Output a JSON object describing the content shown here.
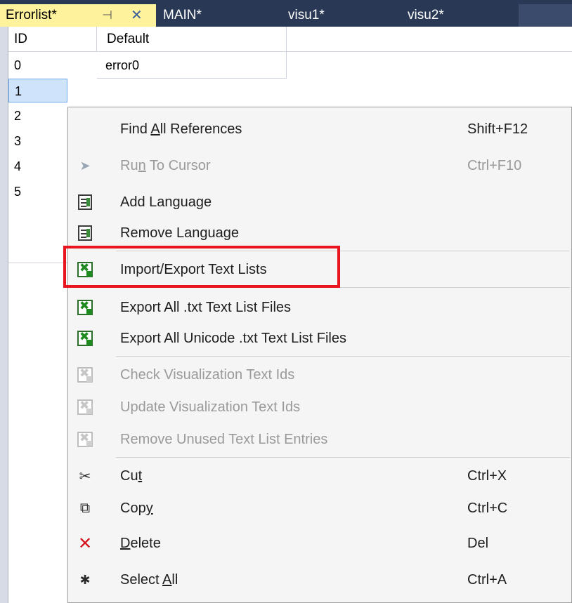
{
  "tabs": [
    {
      "label": "Errorlist*",
      "active": true
    },
    {
      "label": "MAIN*",
      "active": false
    },
    {
      "label": "visu1*",
      "active": false
    },
    {
      "label": "visu2*",
      "active": false
    }
  ],
  "tab_controls": {
    "pin_icon": "pin-icon",
    "close_icon": "close-icon"
  },
  "grid": {
    "columns": [
      "ID",
      "Default"
    ],
    "rows": [
      {
        "id": "0",
        "default": "error0"
      },
      {
        "id": "1",
        "default": ""
      },
      {
        "id": "2",
        "default": ""
      },
      {
        "id": "3",
        "default": ""
      },
      {
        "id": "4",
        "default": ""
      },
      {
        "id": "5",
        "default": ""
      }
    ],
    "selected_row_id": "1"
  },
  "context_menu": {
    "items": [
      {
        "label_pre": "Find ",
        "label_u": "A",
        "label_post": "ll References",
        "shortcut": "Shift+F12",
        "icon": "none",
        "enabled": true
      },
      {
        "label_pre": "Ru",
        "label_u": "n",
        "label_post": " To Cursor",
        "shortcut": "Ctrl+F10",
        "icon": "cursor-icon",
        "enabled": false
      },
      {
        "label": "Add Language",
        "shortcut": "",
        "icon": "language-icon",
        "enabled": true
      },
      {
        "label": "Remove Language",
        "shortcut": "",
        "icon": "language-icon",
        "enabled": true
      },
      {
        "label": "Import/Export Text Lists",
        "shortcut": "",
        "icon": "excel-icon",
        "enabled": true,
        "highlighted": true
      },
      {
        "label": "Export All .txt Text List Files",
        "shortcut": "",
        "icon": "excel-icon",
        "enabled": true
      },
      {
        "label": "Export All Unicode .txt Text List Files",
        "shortcut": "",
        "icon": "excel-icon",
        "enabled": true
      },
      {
        "label": "Check Visualization Text Ids",
        "shortcut": "",
        "icon": "excel-icon",
        "enabled": false
      },
      {
        "label": "Update Visualization Text Ids",
        "shortcut": "",
        "icon": "excel-icon",
        "enabled": false
      },
      {
        "label": "Remove Unused Text List Entries",
        "shortcut": "",
        "icon": "excel-icon",
        "enabled": false
      },
      {
        "label_pre": "Cu",
        "label_u": "t",
        "label_post": "",
        "shortcut": "Ctrl+X",
        "icon": "scissors-icon",
        "enabled": true
      },
      {
        "label_pre": "Cop",
        "label_u": "y",
        "label_post": "",
        "shortcut": "Ctrl+C",
        "icon": "copy-icon",
        "enabled": true
      },
      {
        "label_pre": "",
        "label_u": "D",
        "label_post": "elete",
        "shortcut": "Del",
        "icon": "delete-icon",
        "enabled": true
      },
      {
        "label_pre": "Select ",
        "label_u": "A",
        "label_post": "ll",
        "shortcut": "Ctrl+A",
        "icon": "select-all-icon",
        "enabled": true
      }
    ]
  },
  "colors": {
    "tabbar": "#293955",
    "active_tab": "#fff29d",
    "highlight_box": "#e8141e",
    "delete_icon": "#d4141e"
  }
}
